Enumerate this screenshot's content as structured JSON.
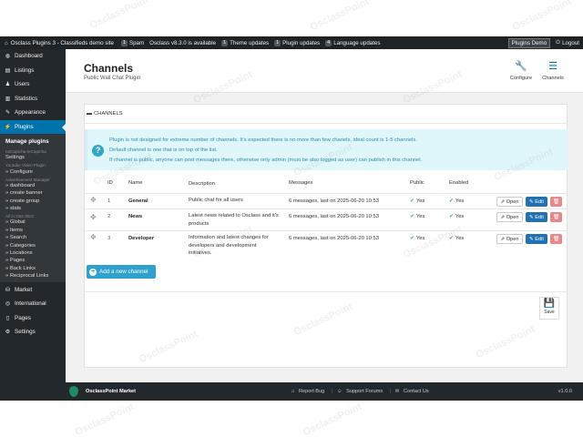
{
  "topbar": {
    "site": "Osclass Plugins 3 - Classifieds demo site",
    "spam_count": "1",
    "spam_label": "Spam",
    "update_notice": "Osclass v8.3.0 is available",
    "theme_count": "1",
    "theme_label": "Theme updates",
    "plugin_count": "1",
    "plugin_label": "Plugin updates",
    "lang_count": "4",
    "lang_label": "Language updates",
    "demo_label": "Plugins Demo",
    "logout_label": "Logout"
  },
  "sidebar": {
    "top_items": [
      {
        "label": "Dashboard",
        "icon": "dashboard-icon"
      },
      {
        "label": "Listings",
        "icon": "listings-icon"
      },
      {
        "label": "Users",
        "icon": "users-icon"
      },
      {
        "label": "Statistics",
        "icon": "statistics-icon"
      },
      {
        "label": "Appearance",
        "icon": "appearance-icon"
      },
      {
        "label": "Plugins",
        "icon": "plugins-icon"
      }
    ],
    "submenu": {
      "manage_plugins": "Manage plugins",
      "recaptcha_head": "noCaptcha reCaptcha",
      "recaptcha_settings": "Settings",
      "youtube_head": "Youtube Video Plugin",
      "youtube_configure": "» Configure",
      "adv_head": "Advertisement Manager",
      "adv_links": [
        "» dashboard",
        "» create banner",
        "» create group",
        "» stats"
      ],
      "seo_head": "All in One SEO",
      "seo_links": [
        "» Global",
        "» Items",
        "» Search",
        "» Categories",
        "» Locations",
        "» Pages",
        "» Back Links",
        "» Reciprocal Links"
      ]
    },
    "bottom_items": [
      {
        "label": "Market",
        "icon": "market-icon"
      },
      {
        "label": "International",
        "icon": "globe-icon"
      },
      {
        "label": "Pages",
        "icon": "pages-icon"
      },
      {
        "label": "Settings",
        "icon": "settings-icon"
      }
    ]
  },
  "header": {
    "title": "Channels",
    "subtitle": "Public Wall Chat Plugin",
    "configure_label": "Configure",
    "channels_label": "Channels"
  },
  "panel": {
    "heading": "CHANNELS",
    "notice_lines": [
      "Plugin is not designed for extreme number of channels. It's expected there is no more than few chanels, ideal count is 1-5 channels.",
      "Default channel is one that is on top of the list.",
      "If channel is public, anyone can post messages there, otherwise only admin (must be also logged as user) can publish in this channel."
    ],
    "columns": {
      "id": "ID",
      "name": "Name",
      "description": "Description",
      "messages": "Messages",
      "public": "Public",
      "enabled": "Enabled"
    },
    "rows": [
      {
        "id": "1",
        "name": "General",
        "description": "Public chat for all users",
        "messages": "6 messages, last on 2025-06-20 10:53",
        "public": "Yes",
        "enabled": "Yes"
      },
      {
        "id": "2",
        "name": "News",
        "description": "Latest news related to Osclass and it's products",
        "messages": "6 messages, last on 2025-06-20 10:53",
        "public": "Yes",
        "enabled": "Yes"
      },
      {
        "id": "3",
        "name": "Developer",
        "description": "Information and latest changes for developers and development initiatives.",
        "messages": "6 messages, last on 2025-06-20 10:53",
        "public": "Yes",
        "enabled": "Yes"
      }
    ],
    "open_label": "Open",
    "edit_label": "Edit",
    "add_label": "Add a new channel",
    "save_label": "Save"
  },
  "footer": {
    "brand": "OsclassPoint Market",
    "report_bug": "Report Bug",
    "support_forums": "Support Forums",
    "contact_us": "Contact Us",
    "version": "v1.0.0"
  },
  "watermark": "OsclassPoint",
  "colors": {
    "accent": "#0073aa",
    "sidebar": "#23282d",
    "notice_bg": "#dff6fb",
    "edit": "#2271b1",
    "delete": "#e8888b",
    "add": "#2ea2cc",
    "success": "#46b450"
  }
}
